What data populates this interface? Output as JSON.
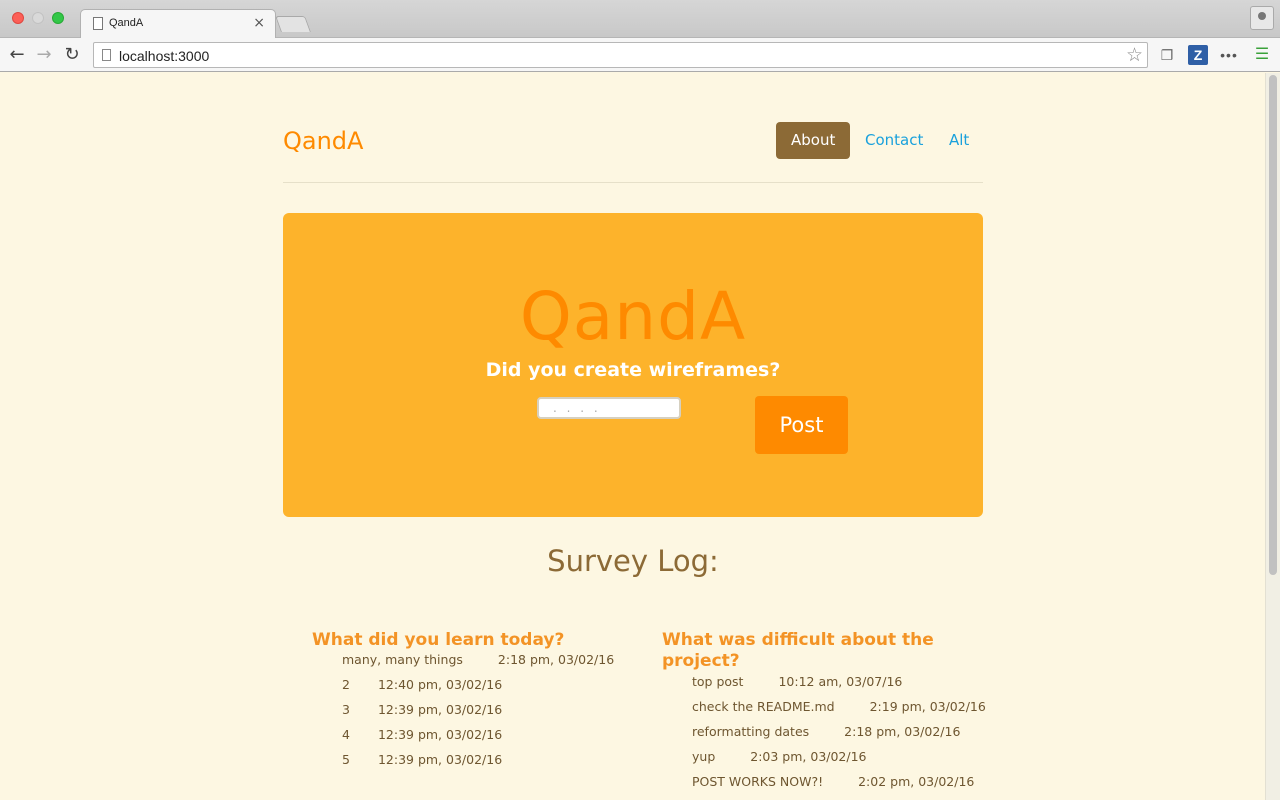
{
  "browser": {
    "tab_title": "QandA",
    "tab_close": "×",
    "url": "localhost:3000",
    "icons": [
      "page-icon",
      "back-icon",
      "forward-icon",
      "reload-icon",
      "star-icon",
      "extension-icon",
      "zotero-icon",
      "more-icon",
      "menu-icon",
      "profile-icon"
    ],
    "back_glyph": "←",
    "forward_glyph": "→",
    "reload_glyph": "↻",
    "star_glyph": "☆",
    "ext_glyph": "❐",
    "zotero_glyph": "Z",
    "more_glyph": "•••",
    "menu_glyph": "☰"
  },
  "header": {
    "brand": "QandA",
    "nav": [
      {
        "label": "About",
        "active": true
      },
      {
        "label": "Contact",
        "active": false
      },
      {
        "label": "Alt",
        "active": false
      }
    ]
  },
  "hero": {
    "title": "QandA",
    "question": "Did you create wireframes?",
    "input_placeholder": ". . . .",
    "input_value": "",
    "post_label": "Post"
  },
  "log": {
    "title": "Survey Log:",
    "questions": [
      {
        "question": "What did you learn today?",
        "answers": [
          {
            "text": "many, many things",
            "time": "2:18 pm, 03/02/16"
          },
          {
            "text": "2",
            "time": "12:40 pm, 03/02/16"
          },
          {
            "text": "3",
            "time": "12:39 pm, 03/02/16"
          },
          {
            "text": "4",
            "time": "12:39 pm, 03/02/16"
          },
          {
            "text": "5",
            "time": "12:39 pm, 03/02/16"
          }
        ]
      },
      {
        "question": "What was difficult about the project?",
        "answers": [
          {
            "text": "top post",
            "time": "10:12 am, 03/07/16"
          },
          {
            "text": "check the README.md",
            "time": "2:19 pm, 03/02/16"
          },
          {
            "text": "reformatting dates",
            "time": "2:18 pm, 03/02/16"
          },
          {
            "text": "yup",
            "time": "2:03 pm, 03/02/16"
          },
          {
            "text": "POST WORKS NOW?!",
            "time": "2:02 pm, 03/02/16"
          }
        ]
      }
    ]
  },
  "colors": {
    "page_bg": "#fdf7e2",
    "brand_orange": "#fe8a00",
    "hero_bg": "#fdb32b",
    "nav_active_bg": "#8c6a36",
    "nav_link": "#1aa1dc",
    "heading_orange": "#f39325",
    "log_text": "#6e5630"
  }
}
